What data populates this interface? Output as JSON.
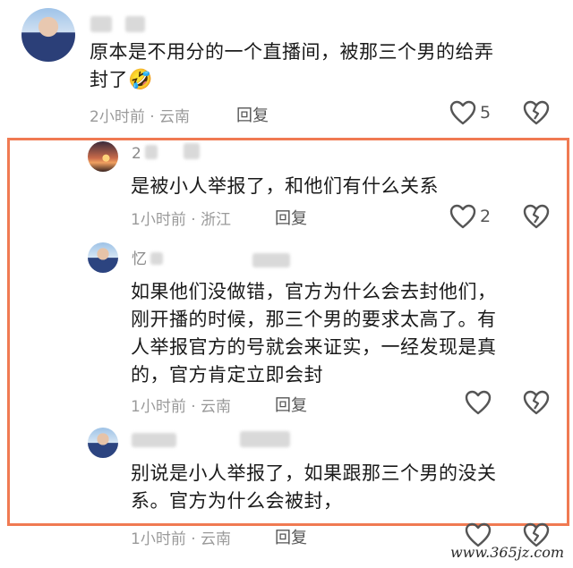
{
  "comments": [
    {
      "name": "",
      "text_lines": [
        "原本是不用分的一个直播间，被那三个男的给弄",
        "封了"
      ],
      "emoji": "🤣",
      "time": "2小时前 · 云南",
      "reply_label": "回复",
      "likes": "5"
    },
    {
      "name": "2",
      "text_lines": [
        "是被小人举报了，和他们有什么关系"
      ],
      "time": "1小时前 · 浙江",
      "reply_label": "回复",
      "likes": "2"
    },
    {
      "name": "忆",
      "text_lines": [
        "如果他们没做错，官方为什么会去封他们，",
        "刚开播的时候，那三个男的要求太高了。有",
        "人举报官方的号就会来证实，一经发现是真",
        "的，官方肯定立即会封"
      ],
      "time": "1小时前 · 云南",
      "reply_label": "回复",
      "likes": ""
    },
    {
      "name": "",
      "text_lines": [
        "别说是小人举报了，如果跟那三个男的没关",
        "系。官方为什么会被封，"
      ],
      "time": "1小时前 · 云南",
      "reply_label": "回复",
      "likes": ""
    }
  ],
  "highlight_color": "#f07a52",
  "watermark": "www.365jz.com",
  "icons": {
    "like": "heart-outline-icon",
    "dislike": "broken-heart-icon"
  }
}
